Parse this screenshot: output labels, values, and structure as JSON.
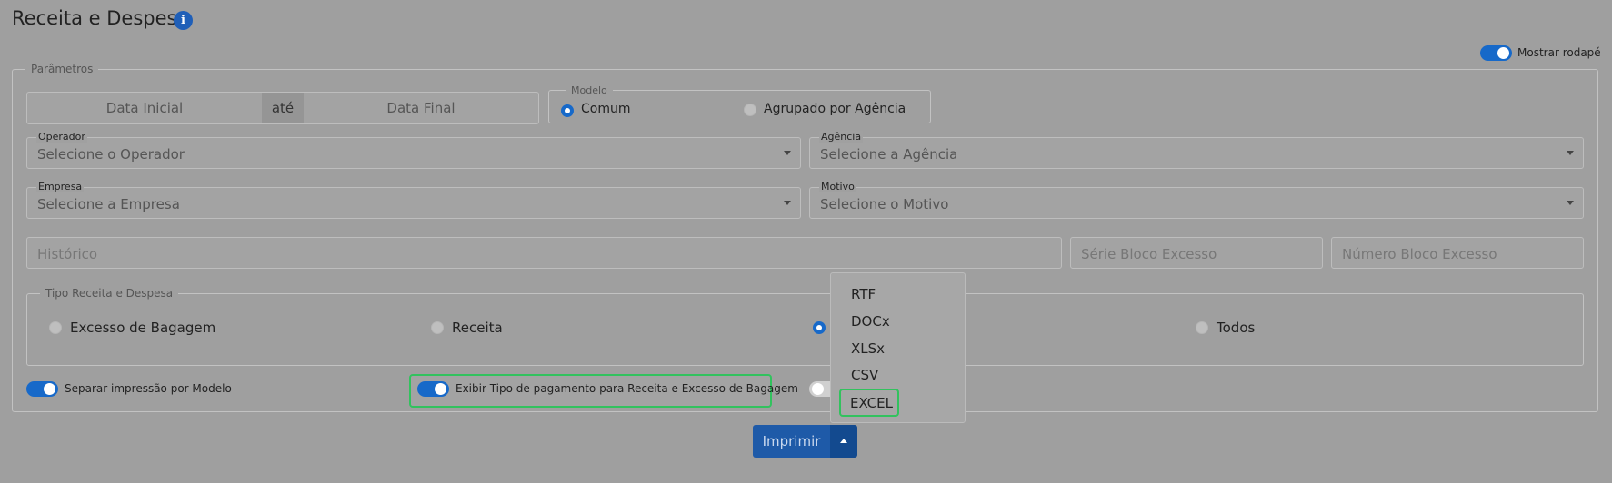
{
  "page": {
    "title": "Receita e Despesa",
    "info_icon": "info-icon"
  },
  "footer_toggle": {
    "label": "Mostrar rodapé",
    "on": true
  },
  "parameters": {
    "legend": "Parâmetros",
    "date_start": {
      "placeholder": "Data Inicial"
    },
    "date_sep": "até",
    "date_end": {
      "placeholder": "Data Final"
    },
    "modelo": {
      "legend": "Modelo",
      "options": [
        {
          "label": "Comum",
          "selected": true
        },
        {
          "label": "Agrupado por Agência",
          "selected": false
        }
      ]
    },
    "operador": {
      "label": "Operador",
      "placeholder": "Selecione o Operador"
    },
    "agencia": {
      "label": "Agência",
      "placeholder": "Selecione a Agência"
    },
    "empresa": {
      "label": "Empresa",
      "placeholder": "Selecione a Empresa"
    },
    "motivo": {
      "label": "Motivo",
      "placeholder": "Selecione o Motivo"
    },
    "historico": {
      "placeholder": "Histórico"
    },
    "serie_bloco": {
      "placeholder": "Série Bloco Excesso"
    },
    "numero_bloco": {
      "placeholder": "Número Bloco Excesso"
    },
    "tipo": {
      "legend": "Tipo Receita e Despesa",
      "options": [
        {
          "label": "Excesso de Bagagem",
          "selected": false
        },
        {
          "label": "Receita",
          "selected": false
        },
        {
          "label": "",
          "selected": true
        },
        {
          "label": "Todos",
          "selected": false
        }
      ]
    },
    "toggles": [
      {
        "label": "Separar impressão por Modelo",
        "on": true
      },
      {
        "label": "Exibir Tipo de pagamento para Receita e Excesso de Bagagem",
        "on": true
      },
      {
        "label": "",
        "on": false
      }
    ]
  },
  "print": {
    "button_label": "Imprimir",
    "menu": [
      "RTF",
      "DOCx",
      "XLSx",
      "CSV",
      "EXCEL"
    ],
    "highlighted": "EXCEL"
  }
}
